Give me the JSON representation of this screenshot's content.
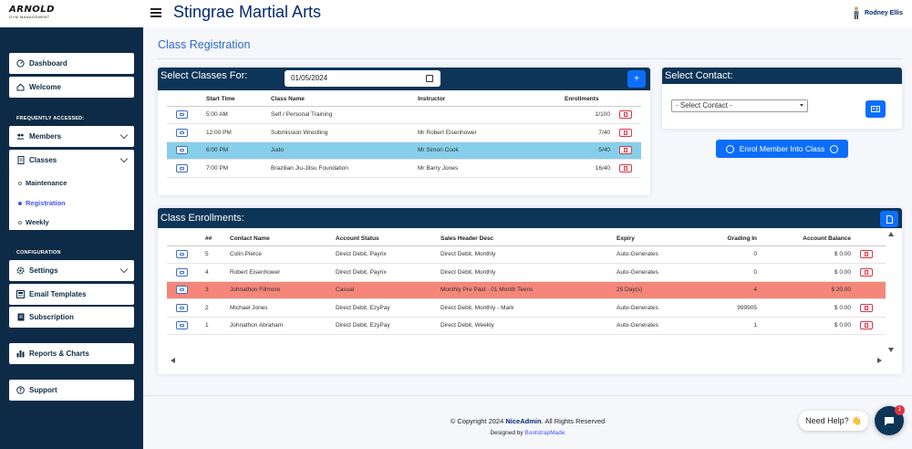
{
  "brand": {
    "line1": "ARNOLD",
    "line2": "GYM MANAGEMENT"
  },
  "app_title": "Stingrae Martial Arts",
  "user": {
    "name": "Rodney Ellis"
  },
  "sidebar": {
    "dashboard": "Dashboard",
    "welcome": "Welcome",
    "frequently_accessed": "FREQUENTLY ACCESSED:",
    "members": "Members",
    "classes": "Classes",
    "classes_sub": [
      "Maintenance",
      "Registration",
      "Weekly"
    ],
    "configuration": "CONFIGURATION",
    "settings": "Settings",
    "email_templates": "Email Templates",
    "subscription": "Subscription",
    "reports": "Reports & Charts",
    "support": "Support"
  },
  "page_title": "Class Registration",
  "select_classes": {
    "title": "Select Classes For:",
    "date": "01/05/2024",
    "add_label": "+",
    "columns": [
      "Start Time",
      "Class Name",
      "Instructor",
      "Enrollments"
    ],
    "rows": [
      {
        "time": "5:00 AM",
        "name": "Self / Personal Training",
        "instructor": "",
        "enrollments": "1/100"
      },
      {
        "time": "12:00 PM",
        "name": "Submission Wrestling",
        "instructor": "Mr Robert Eisenhower",
        "enrollments": "7/40"
      },
      {
        "time": "6:00 PM",
        "name": "Judo",
        "instructor": "Mr Simon Cook",
        "enrollments": "5/40"
      },
      {
        "time": "7:00 PM",
        "name": "Brazilian Jiu-Jitsu Foundation",
        "instructor": "Mr Barry Jones",
        "enrollments": "16/40"
      }
    ]
  },
  "select_contact": {
    "title": "Select Contact:",
    "placeholder": "- Select Contact -",
    "enrol_label": "Enrol Member Into Class"
  },
  "enrollments": {
    "title": "Class Enrollments:",
    "columns": [
      "##",
      "Contact Name",
      "Account Status",
      "Sales Header Desc",
      "Expiry",
      "Grading In",
      "Account Balance"
    ],
    "rows": [
      {
        "num": "5",
        "name": "Colin Pierce",
        "status": "Direct Debit, Payrix",
        "desc": "Direct Debit, Monthly",
        "expiry": "Auto-Generates",
        "grading": "0",
        "balance": "$ 0.00"
      },
      {
        "num": "4",
        "name": "Robert Eisenhower",
        "status": "Direct Debit, Payrix",
        "desc": "Direct Debit, Monthly",
        "expiry": "Auto-Generates",
        "grading": "0",
        "balance": "$ 0.00"
      },
      {
        "num": "3",
        "name": "Johnathon Fillmore",
        "status": "Casual",
        "desc": "Monthly Pre Paid - 01 Month Teens",
        "expiry": "25 Day(s)",
        "grading": "4",
        "balance": "$ 20.00"
      },
      {
        "num": "2",
        "name": "Michael Jones",
        "status": "Direct Debit, EzyPay",
        "desc": "Direct Debit, Monthly - Mark",
        "expiry": "Auto-Generates",
        "grading": "999905",
        "balance": "$ 0.00"
      },
      {
        "num": "1",
        "name": "Johnathon Abraham",
        "status": "Direct Debit, EzyPay",
        "desc": "Direct Debit, Weekly",
        "expiry": "Auto-Generates",
        "grading": "1",
        "balance": "$ 0.00"
      }
    ]
  },
  "footer": {
    "copyright_pre": "© Copyright 2024",
    "copyright_brand": "NiceAdmin",
    "copyright_post": ". All Rights Reserved",
    "designed_pre": "Designed by",
    "designed_link": "BootstrapMade"
  },
  "help": {
    "label": "Need Help?",
    "emoji": "👋",
    "badge": "1"
  },
  "colors": {
    "sidebar": "#0d2b46",
    "accent": "#0d6efd",
    "highlight_blue": "#87ceeb",
    "highlight_red": "#f4877a"
  }
}
